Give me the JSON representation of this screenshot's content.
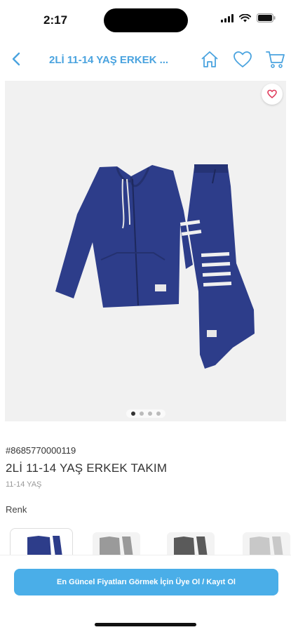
{
  "status": {
    "time": "2:17"
  },
  "nav": {
    "title": "2Lİ 11-14 YAŞ  ERKEK ...",
    "icons": [
      "back-icon",
      "home-icon",
      "heart-icon",
      "cart-icon"
    ],
    "accent": "#4aa3df"
  },
  "product": {
    "image_icon": "tracksuit-product-image",
    "image_index": 1,
    "image_count": 4,
    "sku": "#8685770000119",
    "title": "2Lİ 11-14 YAŞ  ERKEK TAKIM",
    "size": "11-14 YAŞ"
  },
  "variants": {
    "label": "Renk",
    "colors": [
      "navy",
      "grey",
      "anthracite",
      "light-grey"
    ],
    "selected": "navy"
  },
  "cta": {
    "label": "En Güncel Fiyatları Görmek İçin Üye Ol / Kayıt Ol",
    "color": "#4aaee8"
  }
}
